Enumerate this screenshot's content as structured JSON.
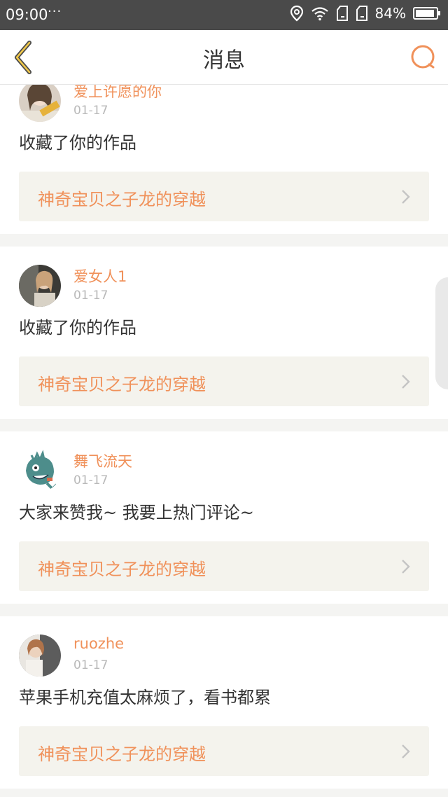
{
  "status": {
    "time": "09:00",
    "dots": "···",
    "battery": "84%"
  },
  "header": {
    "title": "消息"
  },
  "accent": "#f0915a",
  "messages": [
    {
      "user": "爱上许愿的你",
      "date": "01-17",
      "text": "收藏了你的作品",
      "work": "神奇宝贝之子龙的穿越",
      "avatar": "avatar-photo-woman"
    },
    {
      "user": "爱女人1",
      "date": "01-17",
      "text": "收藏了你的作品",
      "work": "神奇宝贝之子龙的穿越",
      "avatar": "avatar-photo-woman-dark"
    },
    {
      "user": "舞飞流天",
      "date": "01-17",
      "text": "大家来赞我~ 我要上热门评论~",
      "work": "神奇宝贝之子龙的穿越",
      "avatar": "avatar-cartoon-creature"
    },
    {
      "user": "ruozhe",
      "date": "01-17",
      "text": "苹果手机充值太麻烦了，看书都累",
      "work": "神奇宝贝之子龙的穿越",
      "avatar": "avatar-photo-woman-light"
    }
  ]
}
